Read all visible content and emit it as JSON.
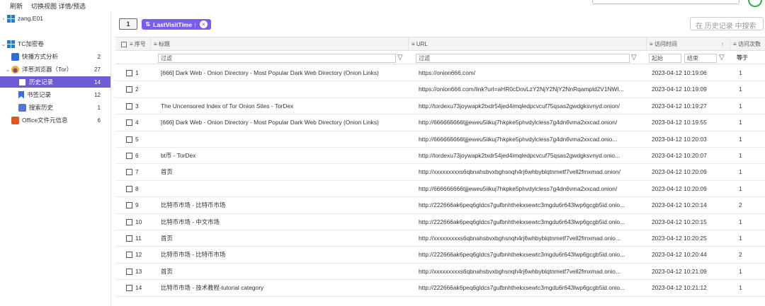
{
  "menu": {
    "refresh": "刷新",
    "switch_view": "切换视图 详情/预选"
  },
  "sidebar": {
    "device": "zang.E01",
    "items": [
      {
        "label": "TC加密卷",
        "count": ""
      },
      {
        "label": "快播方式分析",
        "count": "2"
      },
      {
        "label": "洋葱浏览器（Tor）",
        "count": "27"
      },
      {
        "label": "历史记录",
        "count": "14"
      },
      {
        "label": "书签记录",
        "count": "12"
      },
      {
        "label": "搜索历史",
        "count": "1"
      },
      {
        "label": "Office文件元信息",
        "count": "6"
      }
    ]
  },
  "toolbar": {
    "view_icon_text": "1",
    "sort_label": "LastVisitTime ↑",
    "sort_clear": "✕",
    "search_placeholder": "在 历史记录 中搜索"
  },
  "table": {
    "columns": {
      "no": "序号",
      "title": "标题",
      "url": "URL",
      "time": "访问时间",
      "visits": "访问次数"
    },
    "filters": {
      "title": "过滤",
      "url": "过滤",
      "start": "起始",
      "end": "结束",
      "cmp": "等于"
    },
    "rows": [
      {
        "no": "1",
        "title": "[666] Dark Web - Onion Directory - Most Popular Dark Web Directory (Onion Links)",
        "url": "https://onion666.com/",
        "time": "2023-04-12 10:19:06",
        "visits": "1"
      },
      {
        "no": "2",
        "title": "",
        "url": "https://onion666.com/link?url=aHR0cDovLzY2NjY2NjY2NnRqampld2V1NWI...",
        "time": "2023-04-12 10:19:09",
        "visits": "1"
      },
      {
        "no": "3",
        "title": "The Uncensored Index of Tor Onion Sites - TorDex",
        "url": "http://tordexu73joywapk2txdr54jed4imqledpcvcuf75qsas2gwdgksvnyd.onion/",
        "time": "2023-04-12 10:19:27",
        "visits": "1"
      },
      {
        "no": "4",
        "title": "[666] Dark Web - Onion Directory - Most Popular Dark Web Directory (Onion Links)",
        "url": "http://666666666tjjjeweu5iikuj7hkpke5phvdylcless7g4dn6vma2xxcad.onion/",
        "time": "2023-04-12 10:19:55",
        "visits": "1"
      },
      {
        "no": "5",
        "title": "",
        "url": "http://666666666tjjjeweu5iikuj7hkpke5phvdylcless7g4dn6vma2xxcad.onio...",
        "time": "2023-04-12 10:20:03",
        "visits": "1"
      },
      {
        "no": "6",
        "title": "bt币 - TorDex",
        "url": "http://tordexu73joywapk2txdr54jed4imqledpcvcuf75qsas2gwdgksvnyd.onio...",
        "time": "2023-04-12 10:20:07",
        "visits": "1"
      },
      {
        "no": "7",
        "title": "首页",
        "url": "http://xxxxxxxxxs6qbnahsbvxbghsnqh4rj6whbyblqtnmetf7vell2fmxmad.onion/",
        "time": "2023-04-12 10:20:09",
        "visits": "1"
      },
      {
        "no": "8",
        "title": "",
        "url": "http://666666666tjjjeweu5iikuj7hkpke5phvdylcless7g4dn6vma2xxcad.onion/",
        "time": "2023-04-12 10:20:09",
        "visits": "1"
      },
      {
        "no": "9",
        "title": "比特币市场 - 比特币市场",
        "url": "http://222666ak6peq6gldcs7gufbnhthekxsewtc3mgdu6r643lwp6gcgb5id.onio...",
        "time": "2023-04-12 10:20:14",
        "visits": "2"
      },
      {
        "no": "10",
        "title": "比特币市场 - 中文市场",
        "url": "http://222666ak6peq6gldcs7gufbnhthekxsewtc3mgdu6r643lwp6gcgb5id.onio...",
        "time": "2023-04-12 10:20:15",
        "visits": "1"
      },
      {
        "no": "11",
        "title": "首页",
        "url": "http://xxxxxxxxxs6qbnahsbvxbghsnqh4rj6whbyblqtnmetf7vell2fmxmad.onio...",
        "time": "2023-04-12 10:20:25",
        "visits": "1"
      },
      {
        "no": "12",
        "title": "比特币市场 - 比特币市场",
        "url": "http://222666ak6peq6gldcs7gufbnhthekxsewtc3mgdu6r643lwp6gcgb5id.onio...",
        "time": "2023-04-12 10:20:44",
        "visits": "2"
      },
      {
        "no": "13",
        "title": "首页",
        "url": "http://xxxxxxxxxs6qbnahsbvxbghsnqh4rj6whbyblqtnmetf7vell2fmxmad.onio...",
        "time": "2023-04-12 10:21:09",
        "visits": "1"
      },
      {
        "no": "14",
        "title": "比特币市场 - 技术教程-tutorial category",
        "url": "http://222666ak6peq6gldcs7gufbnhthekxsewtc3mgdu6r643lwp6gcgb5id.onio...",
        "time": "2023-04-12 10:21:12",
        "visits": "1"
      }
    ]
  }
}
